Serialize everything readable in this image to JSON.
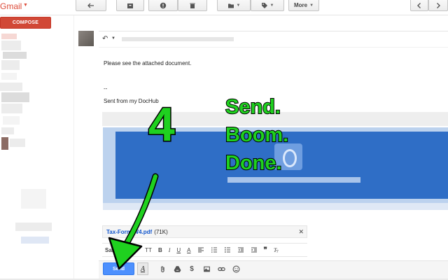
{
  "app": {
    "brand": "Gmail"
  },
  "toolbar": {
    "compose_label": "COMPOSE",
    "more_label": "More",
    "icons": [
      "back-arrow-icon",
      "archive-icon",
      "report-spam-icon",
      "trash-icon",
      "folder-icon",
      "label-icon",
      "chevron-left-icon",
      "chevron-right-icon"
    ]
  },
  "message": {
    "line1": "Please see the attached document.",
    "separator": "--",
    "signature": "Sent from my DocHub"
  },
  "overlay": {
    "step": "4",
    "words": [
      "Send.",
      "Boom.",
      "Done."
    ]
  },
  "attachment": {
    "name": "Tax-Form-W4.pdf",
    "size": "(71K)"
  },
  "format": {
    "font": "Sans Serif",
    "size_icon": "TT",
    "bold": "B",
    "italic": "I",
    "underline": "U",
    "text_color": "A"
  },
  "compose": {
    "send_label": "Send",
    "format_toggle": "A"
  },
  "colors": {
    "compose_red": "#d14836",
    "send_blue": "#4d90fe",
    "overlay_green": "#1fd11f",
    "banner_blue": "#2f6ec6"
  }
}
